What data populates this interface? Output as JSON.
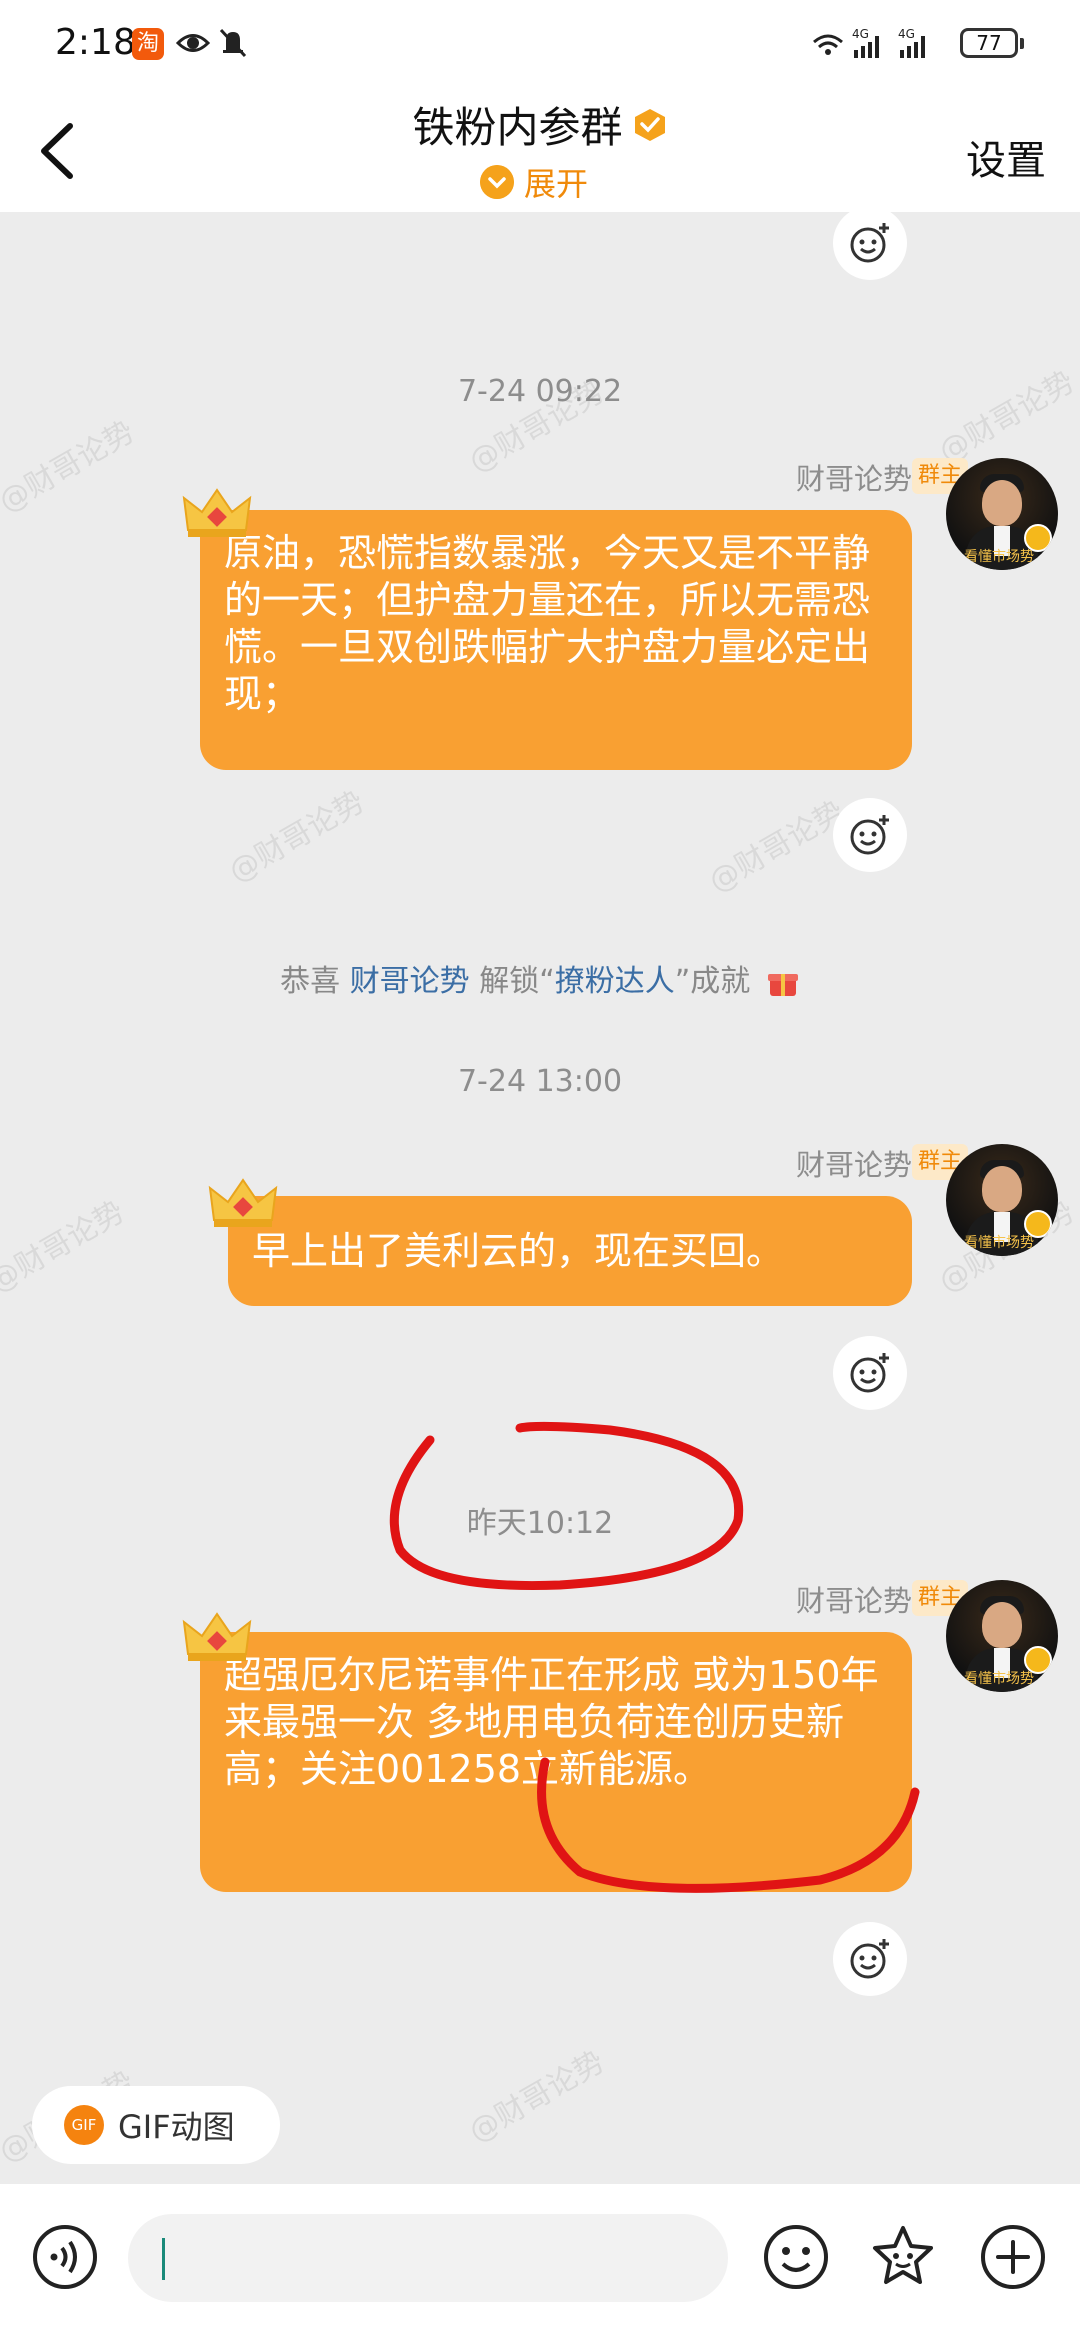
{
  "status": {
    "time": "2:18",
    "taobao_glyph": "淘",
    "battery": "77",
    "net1": "4G",
    "net2": "4G"
  },
  "header": {
    "title": "铁粉内参群",
    "expand_label": "展开",
    "settings_label": "设置"
  },
  "watermark": "@财哥论势",
  "timestamps": [
    "7-24 09:22",
    "7-24 13:00",
    "昨天10:12"
  ],
  "sender": {
    "name": "财哥论势",
    "tag": "群主",
    "avatar_caption": "看懂市场势"
  },
  "messages": [
    {
      "text": "原油，恐慌指数暴涨，今天又是不平静的一天；但护盘力量还在，所以无需恐慌。一旦双创跌幅扩大护盘力量必定出现；"
    },
    {
      "text": "早上出了美利云的，现在买回。"
    },
    {
      "text": "超强厄尔尼诺事件正在形成 或为150年来最强一次 多地用电负荷连创历史新高；关注001258立新能源。"
    }
  ],
  "system_msg": {
    "prefix": "恭喜 ",
    "user": "财哥论势",
    "mid": " 解锁“",
    "achievement": "撩粉达人",
    "suffix": "”成就"
  },
  "gif_chip": {
    "icon": "GIF",
    "label": "GIF动图"
  },
  "input": {
    "value": ""
  },
  "colors": {
    "bubble": "#f9a032",
    "accent": "#f08a0a",
    "background": "#ececec",
    "annotation": "#e01414"
  },
  "icons": [
    "back-arrow-icon",
    "verified-badge-icon",
    "emoji-react-icon",
    "crown-icon",
    "gift-icon",
    "voice-icon",
    "emoji-icon",
    "sticker-icon",
    "plus-icon"
  ]
}
